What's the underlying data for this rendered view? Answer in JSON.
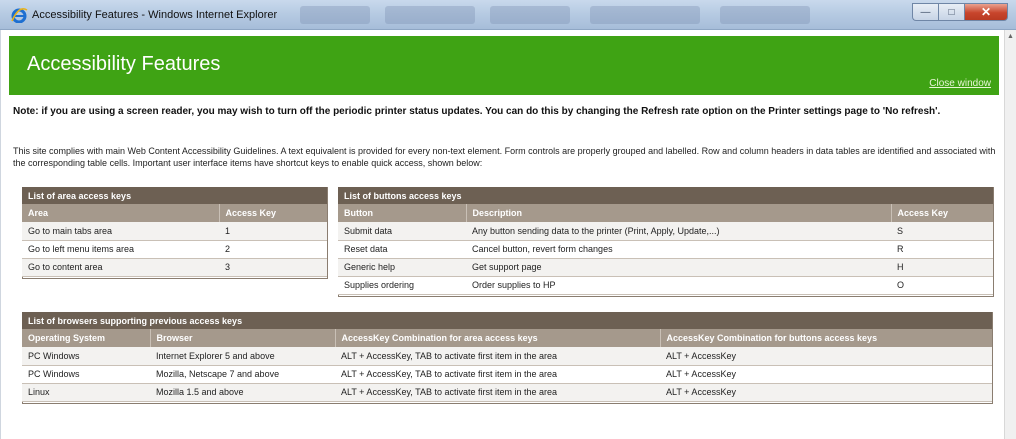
{
  "window": {
    "title": "Accessibility Features - Windows Internet Explorer",
    "icon": "ie-icon",
    "buttons": [
      "minimize-icon",
      "maximize-icon",
      "close-icon"
    ],
    "close_glyph": "✕",
    "minimize_glyph": "—",
    "maximize_glyph": "□"
  },
  "header": {
    "title": "Accessibility Features",
    "close_link": "Close window",
    "accent": "#3fa314"
  },
  "note": "Note: if you are using a screen reader, you may wish to turn off the periodic printer status updates. You can do this by changing the Refresh rate option on the Printer settings page to 'No refresh'.",
  "intro": "This site complies with main Web Content Accessibility Guidelines. A text equivalent is provided for every non-text element. Form controls are properly grouped and labelled. Row and column headers in data tables are identified and associated with the corresponding table cells. Important user interface items have shortcut keys to enable quick access, shown below:",
  "area_table": {
    "caption": "List of area access keys",
    "headers": [
      "Area",
      "Access Key"
    ],
    "rows": [
      [
        "Go to main tabs area",
        "1"
      ],
      [
        "Go to left menu items area",
        "2"
      ],
      [
        "Go to content area",
        "3"
      ]
    ]
  },
  "buttons_table": {
    "caption": "List of buttons access keys",
    "headers": [
      "Button",
      "Description",
      "Access Key"
    ],
    "rows": [
      [
        "Submit data",
        "Any button sending data to the printer (Print, Apply, Update,...)",
        "S"
      ],
      [
        "Reset data",
        "Cancel button, revert form changes",
        "R"
      ],
      [
        "Generic help",
        "Get support page",
        "H"
      ],
      [
        "Supplies ordering",
        "Order supplies to HP",
        "O"
      ]
    ]
  },
  "browsers_table": {
    "caption": "List of browsers supporting previous access keys",
    "headers": [
      "Operating System",
      "Browser",
      "AccessKey Combination for area access keys",
      "AccessKey Combination for buttons access keys"
    ],
    "rows": [
      [
        "PC Windows",
        "Internet Explorer 5 and above",
        "ALT + AccessKey, TAB to activate first item in the area",
        "ALT + AccessKey"
      ],
      [
        "PC Windows",
        "Mozilla, Netscape 7 and above",
        "ALT + AccessKey, TAB to activate first item in the area",
        "ALT + AccessKey"
      ],
      [
        "Linux",
        "Mozilla 1.5 and above",
        "ALT + AccessKey, TAB to activate first item in the area",
        "ALT + AccessKey"
      ]
    ]
  }
}
